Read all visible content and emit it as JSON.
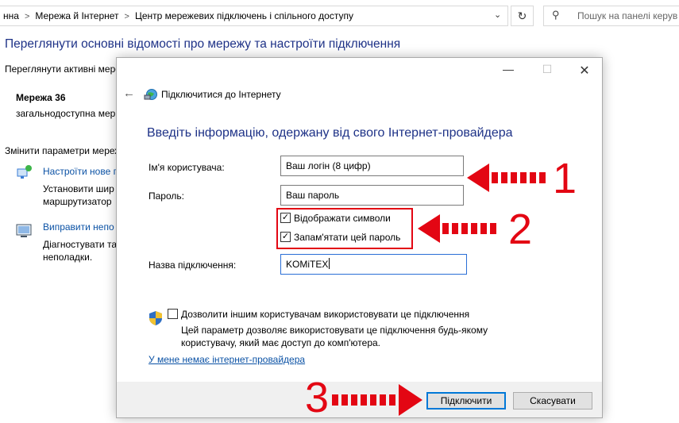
{
  "address_bar": {
    "breadcrumbs": [
      "нна",
      "Мережа й Інтернет",
      "Центр мережевих підключень і спільного доступу"
    ],
    "search_placeholder": "Пошук на панелі керув"
  },
  "background": {
    "title": "Переглянути основні відомості про мережу та настроїти підключення",
    "active_networks_label": "Переглянути активні мере",
    "network_name": "Мережа 36",
    "network_type": "загальнодоступна мер",
    "change_settings_label": "Змінити параметри мереж",
    "items": [
      {
        "link": "Настроїти нове п",
        "desc_line1": "Установити шир",
        "desc_line2": "маршрутизатор"
      },
      {
        "link": "Виправити непо",
        "desc_line1": "Діагностувати та",
        "desc_line2": "неполадки."
      }
    ]
  },
  "dialog": {
    "window_title": "Підключитися до Інтернету",
    "heading": "Введіть інформацію, одержану від свого Інтернет-провайдера",
    "username_label": "Ім'я користувача:",
    "username_value": "Ваш логін (8 цифр)",
    "password_label": "Пароль:",
    "password_value": "Ваш пароль",
    "show_chars_label": "Відображати символи",
    "show_chars_checked": true,
    "remember_label": "Запам'ятати цей пароль",
    "remember_checked": true,
    "conn_name_label": "Назва підключення:",
    "conn_name_value": "KOMiTEX",
    "allow_others_label": "Дозволити іншим користувачам використовувати це підключення",
    "allow_others_checked": false,
    "allow_note_line1": "Цей параметр дозволяє використовувати це підключення будь-якому",
    "allow_note_line2": "користувачу, який має доступ до комп'ютера.",
    "no_isp_link": "У мене немає інтернет-провайдера",
    "connect_button": "Підключити",
    "cancel_button": "Скасувати"
  },
  "annotations": {
    "step1": "1",
    "step2": "2",
    "step3": "3",
    "color": "#e30613"
  },
  "icons": [
    "chevron-right-icon",
    "chevron-down-icon",
    "refresh-icon",
    "search-icon",
    "back-arrow-icon",
    "network-globe-icon",
    "shield-icon",
    "minimize-icon",
    "maximize-icon",
    "close-icon"
  ]
}
